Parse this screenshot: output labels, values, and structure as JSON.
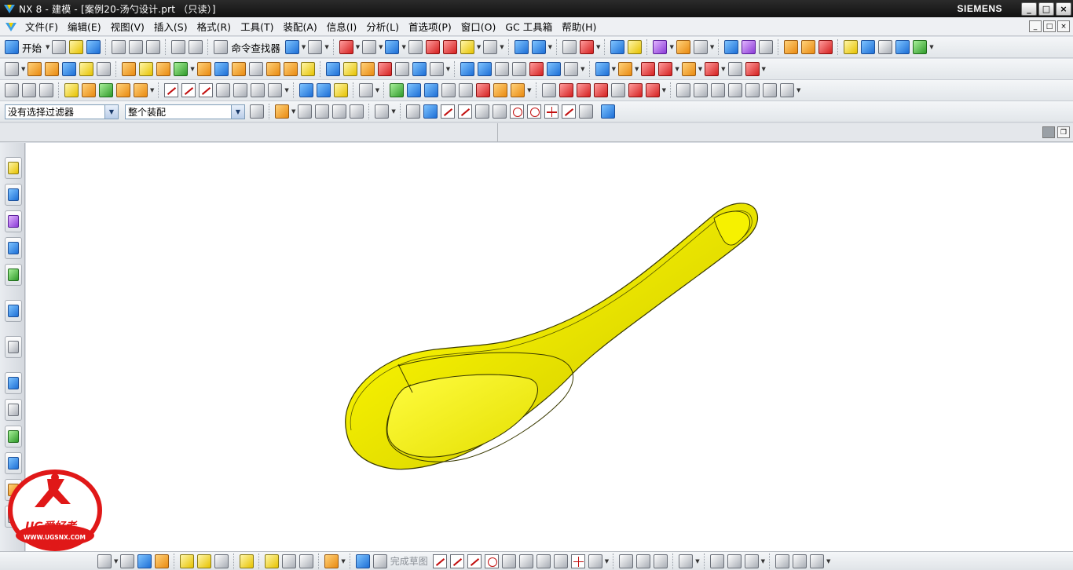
{
  "window": {
    "title": "NX 8 - 建模 - [案例20-汤勺设计.prt （只读）]",
    "brand": "SIEMENS",
    "controls": [
      "_",
      "□",
      "×"
    ]
  },
  "menubar": {
    "items": [
      "文件(F)",
      "编辑(E)",
      "视图(V)",
      "插入(S)",
      "格式(R)",
      "工具(T)",
      "装配(A)",
      "信息(I)",
      "分析(L)",
      "首选项(P)",
      "窗口(O)",
      "GC 工具箱",
      "帮助(H)"
    ],
    "doc_controls": [
      "_",
      "□",
      "×"
    ]
  },
  "toolbar": {
    "start_label": "开始",
    "command_finder_label": "命令查找器"
  },
  "selection_bar": {
    "type_filter": "没有选择过滤器",
    "scope": "整个装配"
  },
  "bottom_toolbar": {
    "finish_sketch_label": "完成草图"
  },
  "watermark": {
    "brand_text": "UG爱好者",
    "url": "WWW.UGSNX.COM"
  },
  "colors": {
    "title_bg": "#1a1a1a",
    "viewport_bg": "#ffffff",
    "model_fill": "#f0ec00",
    "model_edge": "#4a4a00",
    "logo_red": "#e01818"
  }
}
